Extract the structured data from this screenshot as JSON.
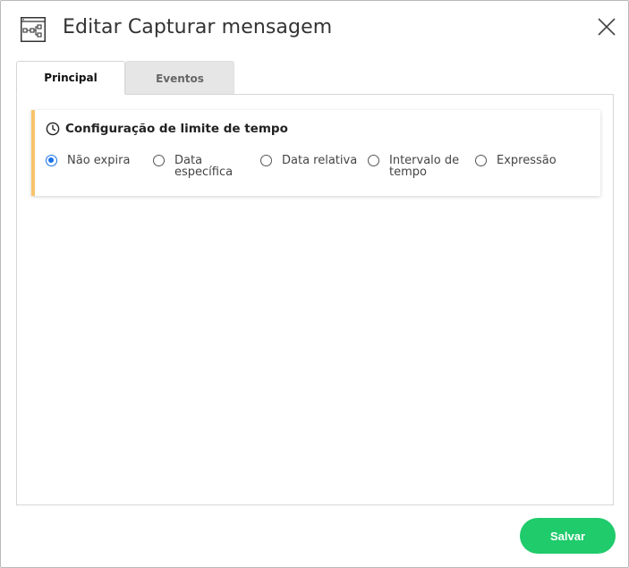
{
  "dialog": {
    "title": "Editar Capturar mensagem",
    "app_icon": "workflow-diagram-icon",
    "close_icon": "close-icon"
  },
  "tabs": [
    {
      "label": "Principal",
      "active": true
    },
    {
      "label": "Eventos",
      "active": false
    }
  ],
  "timeout_card": {
    "title": "Configuração de limite de tempo",
    "icon": "clock-icon",
    "accent_color": "#f7c46c",
    "options": [
      {
        "line1": "Não expira",
        "line2": "",
        "checked": true
      },
      {
        "line1": "Data",
        "line2": "específica",
        "checked": false
      },
      {
        "line1": "Data relativa",
        "line2": "",
        "checked": false
      },
      {
        "line1": "Intervalo de",
        "line2": "tempo",
        "checked": false
      },
      {
        "line1": "Expressão",
        "line2": "",
        "checked": false
      }
    ]
  },
  "footer": {
    "save_label": "Salvar",
    "save_color": "#1fcb6b"
  }
}
